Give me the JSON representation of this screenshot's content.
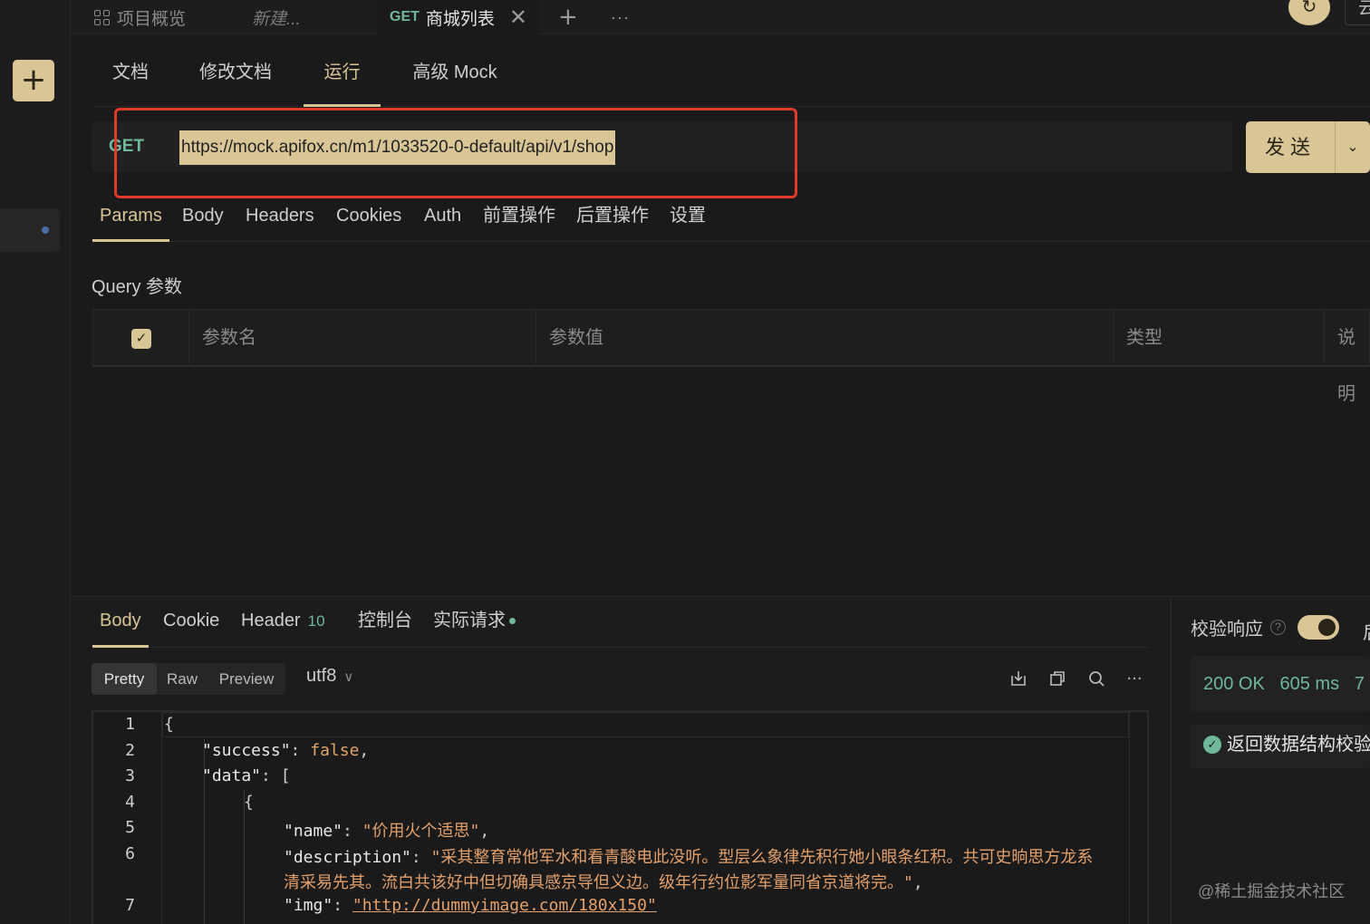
{
  "top_tabs": {
    "overview": "项目概览",
    "new": "新建...",
    "active_method": "GET",
    "active_title": "商城列表",
    "close": "✕",
    "plus": "+",
    "more": "···",
    "cloud_cut": "云"
  },
  "sub_tabs": [
    "文档",
    "修改文档",
    "运行",
    "高级 Mock"
  ],
  "request": {
    "method": "GET",
    "url": "https://mock.apifox.cn/m1/1033520-0-default/api/v1/shop",
    "send_label": "发送"
  },
  "request_tabs": [
    "Params",
    "Body",
    "Headers",
    "Cookies",
    "Auth",
    "前置操作",
    "后置操作",
    "设置"
  ],
  "query_label": "Query 参数",
  "params_headers": [
    "参数名",
    "参数值",
    "类型",
    "说明"
  ],
  "response": {
    "tabs": [
      "Body",
      "Cookie",
      "Header",
      "控制台",
      "实际请求"
    ],
    "header_count": "10",
    "formats": [
      "Pretty",
      "Raw",
      "Preview"
    ],
    "encoding": "utf8",
    "lines": {
      "l1": "{",
      "l2k": "\"success\"",
      "l2v": "false",
      "l3k": "\"data\"",
      "l3v": "[",
      "l4": "{",
      "l5k": "\"name\"",
      "l5v": "\"价用火个适思\"",
      "l6k": "\"description\"",
      "l6v": "\"采其整育常他军水和看青酸电此没听。型层么象律先积行她小眼条红积。共可史晌思方龙系",
      "l6c": "清采易先其。流白共该好中但切确具感京导但义边。级年行约位影军量同省京道将完。\"",
      "l7k": "\"img\"",
      "l7v": "\"http://dummyimage.com/180x150\""
    }
  },
  "right_panel": {
    "verify_label": "校验响应",
    "status": "200 OK",
    "time": "605 ms",
    "size_cut": "7",
    "check_label": "返回数据结构校验"
  },
  "watermark": "@稀土掘金技术社区",
  "icons": {
    "rail_add": "plus-icon",
    "sync": "sync-icon",
    "download": "download-icon",
    "copy": "copy-icon",
    "search": "search-icon",
    "more": "more-icon"
  },
  "colors": {
    "accent": "#d9c596",
    "method_green": "#6fb89a",
    "highlight_red": "#e03a2c"
  }
}
